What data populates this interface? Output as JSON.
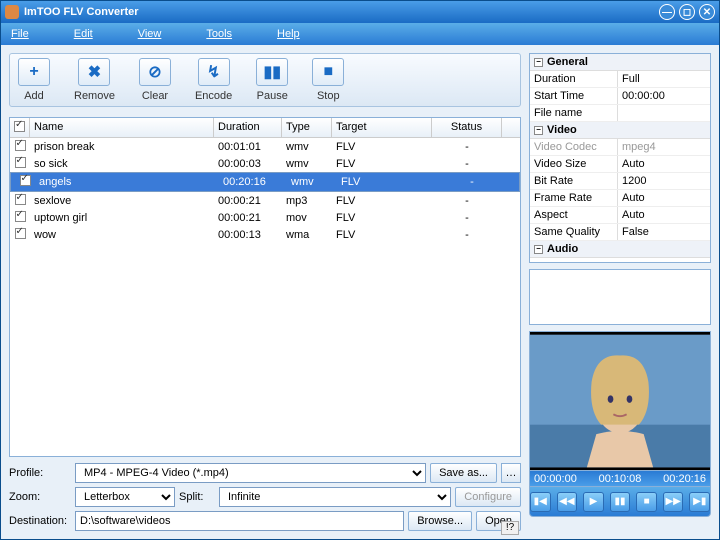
{
  "window": {
    "title": "ImTOO FLV Converter"
  },
  "menu": [
    "File",
    "Edit",
    "View",
    "Tools",
    "Help"
  ],
  "toolbar": [
    {
      "label": "Add"
    },
    {
      "label": "Remove"
    },
    {
      "label": "Clear"
    },
    {
      "label": "Encode"
    },
    {
      "label": "Pause"
    },
    {
      "label": "Stop"
    }
  ],
  "list": {
    "headers": [
      "Name",
      "Duration",
      "Type",
      "Target",
      "Status"
    ],
    "rows": [
      {
        "checked": true,
        "name": "prison break",
        "duration": "00:01:01",
        "type": "wmv",
        "target": "FLV",
        "status": "-",
        "selected": false
      },
      {
        "checked": true,
        "name": "so sick",
        "duration": "00:00:03",
        "type": "wmv",
        "target": "FLV",
        "status": "-",
        "selected": false
      },
      {
        "checked": true,
        "name": "angels",
        "duration": "00:20:16",
        "type": "wmv",
        "target": "FLV",
        "status": "-",
        "selected": true
      },
      {
        "checked": true,
        "name": "sexlove",
        "duration": "00:00:21",
        "type": "mp3",
        "target": "FLV",
        "status": "-",
        "selected": false
      },
      {
        "checked": true,
        "name": "uptown girl",
        "duration": "00:00:21",
        "type": "mov",
        "target": "FLV",
        "status": "-",
        "selected": false
      },
      {
        "checked": true,
        "name": "wow",
        "duration": "00:00:13",
        "type": "wma",
        "target": "FLV",
        "status": "-",
        "selected": false
      }
    ]
  },
  "form": {
    "profile_label": "Profile:",
    "profile_value": "MP4 - MPEG-4 Video (*.mp4)",
    "save_as": "Save as...",
    "zoom_label": "Zoom:",
    "zoom_value": "Letterbox",
    "split_label": "Split:",
    "split_value": "Infinite",
    "configure": "Configure",
    "dest_label": "Destination:",
    "dest_value": "D:\\software\\videos",
    "browse": "Browse...",
    "open": "Open"
  },
  "props": {
    "groups": [
      {
        "name": "General",
        "rows": [
          {
            "k": "Duration",
            "v": "Full"
          },
          {
            "k": "Start Time",
            "v": "00:00:00"
          },
          {
            "k": "File name",
            "v": ""
          }
        ]
      },
      {
        "name": "Video",
        "rows": [
          {
            "k": "Video Codec",
            "v": "mpeg4",
            "codec": true
          },
          {
            "k": "Video Size",
            "v": "Auto"
          },
          {
            "k": "Bit Rate",
            "v": "1200"
          },
          {
            "k": "Frame Rate",
            "v": "Auto"
          },
          {
            "k": "Aspect",
            "v": "Auto"
          },
          {
            "k": "Same Quality",
            "v": "False"
          }
        ]
      },
      {
        "name": "Audio",
        "rows": []
      }
    ]
  },
  "player": {
    "time_start": "00:00:00",
    "time_current": "00:10:08",
    "time_end": "00:20:16"
  }
}
